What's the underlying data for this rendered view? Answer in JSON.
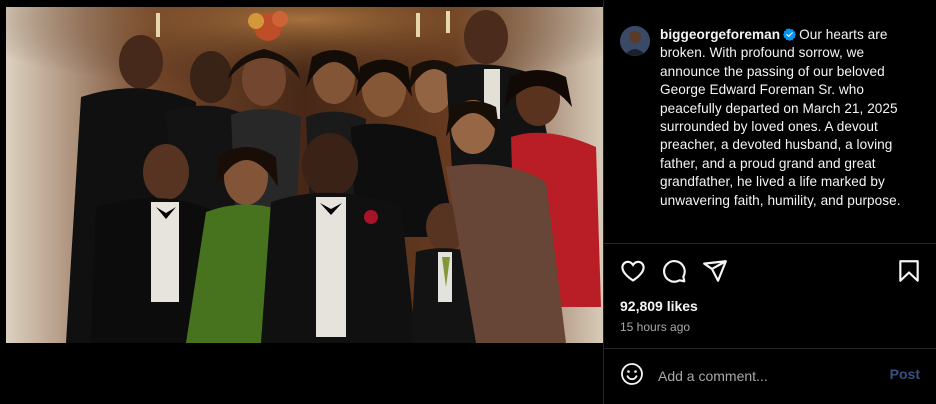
{
  "post": {
    "username": "biggeorgeforeman",
    "caption": "Our hearts are broken. With profound sorrow, we announce the passing of our beloved George Edward Foreman Sr. who peacefully departed on March 21, 2025 surrounded by loved ones. A devout preacher, a devoted husband, a loving father, and a proud grand and great grandfather, he lived a life marked by unwavering faith, humility, and purpose.",
    "likes": "92,809 likes",
    "timestamp": "15 hours ago",
    "verified": true,
    "photo_subject": "Family group portrait in formal attire"
  },
  "actions": {
    "like_icon": "heart-icon",
    "comment_icon": "comment-icon",
    "share_icon": "share-icon",
    "save_icon": "bookmark-icon"
  },
  "comment": {
    "placeholder": "Add a comment...",
    "post_label": "Post",
    "emoji_icon": "emoji-icon"
  },
  "colors": {
    "background": "#000000",
    "text": "#f5f5f5",
    "secondary_text": "#a8a8a8",
    "verified_blue": "#0095f6",
    "post_disabled": "#385185",
    "divider": "#262626"
  }
}
